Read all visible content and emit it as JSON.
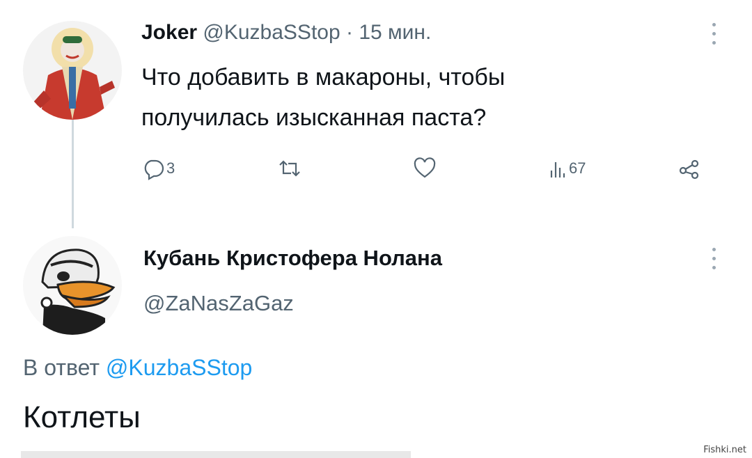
{
  "tweet": {
    "author_name": "Joker",
    "author_handle": "@KuzbaSStop",
    "separator": "·",
    "time": "15 мин.",
    "text_line1": "Что добавить в макароны, чтобы",
    "text_line2": "получилась изысканная паста?",
    "actions": {
      "reply_count": "3",
      "retweet_count": "",
      "like_count": "",
      "views_count": "67"
    },
    "more_icon": "more-vertical-icon"
  },
  "reply": {
    "author_name": "Кубань Кристофера Нолана",
    "author_handle": "@ZaNasZaGaz",
    "reply_prefix": "В ответ",
    "reply_to_handle": "@KuzbaSStop",
    "text": "Котлеты",
    "more_icon": "more-vertical-icon"
  },
  "watermark": "Fishki.net",
  "colors": {
    "text": "#0f1419",
    "muted": "#536471",
    "link": "#1d9bf0",
    "thread_line": "#cfd9de"
  }
}
